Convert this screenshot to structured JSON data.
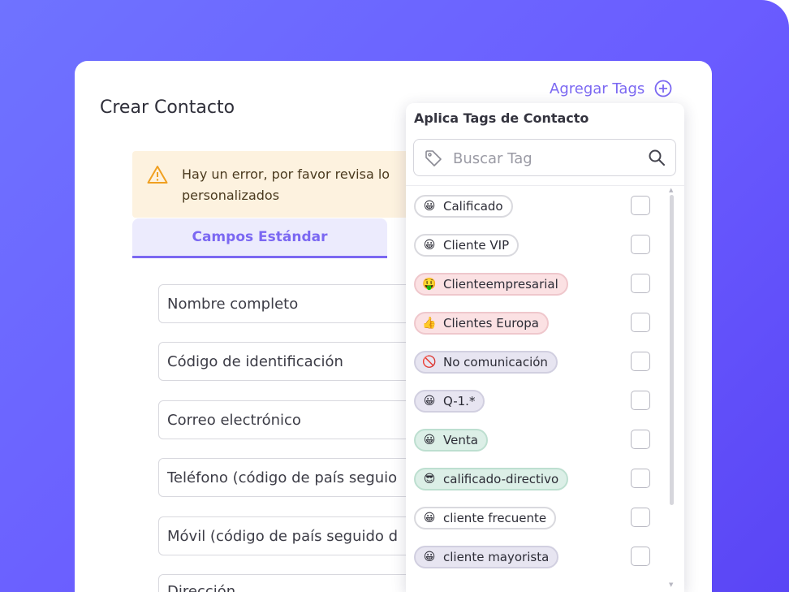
{
  "page": {
    "title": "Crear Contacto",
    "add_tags_label": "Agregar Tags",
    "alert": {
      "line1": "Hay un error, por favor revisa lo",
      "line2": "personalizados"
    },
    "tab_standard": "Campos Estándar",
    "fields": [
      {
        "label": "Nombre completo"
      },
      {
        "label": "Código de identificación"
      },
      {
        "label": "Correo electrónico"
      },
      {
        "label": "Teléfono (código de país seguio"
      },
      {
        "label": "Móvil (código de país seguido d"
      },
      {
        "label": "Dirección"
      }
    ]
  },
  "dropdown": {
    "title": "Aplica Tags de Contacto",
    "search_placeholder": "Buscar Tag",
    "tags": [
      {
        "label": "Calificado",
        "emoji": "😀",
        "bg": "#ffffff",
        "border": "#d9d9de"
      },
      {
        "label": "Cliente VIP",
        "emoji": "😀",
        "bg": "#ffffff",
        "border": "#d9d9de"
      },
      {
        "label": "Clienteempresarial",
        "emoji": "🤑",
        "bg": "#fbe1e3",
        "border": "#efc7cc"
      },
      {
        "label": "Clientes Europa",
        "emoji": "👍",
        "bg": "#fbe1e3",
        "border": "#efc7cc"
      },
      {
        "label": "No comunicación",
        "emoji": "🚫",
        "bg": "#e7e5f1",
        "border": "#d1cfe0"
      },
      {
        "label": "Q-1.*",
        "emoji": "😀",
        "bg": "#e7e5f1",
        "border": "#d1cfe0"
      },
      {
        "label": "Venta",
        "emoji": "😀",
        "bg": "#dcefe7",
        "border": "#bddfd0"
      },
      {
        "label": "calificado-directivo",
        "emoji": "😎",
        "bg": "#dcefe7",
        "border": "#bddfd0"
      },
      {
        "label": "cliente frecuente",
        "emoji": "😀",
        "bg": "#ffffff",
        "border": "#d9d9de"
      },
      {
        "label": "cliente mayorista",
        "emoji": "😀",
        "bg": "#e7e5f1",
        "border": "#d1cfe0"
      }
    ]
  },
  "colors": {
    "accent": "#7b68f2",
    "alert_bg": "#fdf2df",
    "warning": "#f0a020"
  },
  "icons": {
    "add": "plus-circle-icon",
    "warning": "warning-triangle-icon",
    "tag": "tag-icon",
    "search": "search-icon"
  }
}
